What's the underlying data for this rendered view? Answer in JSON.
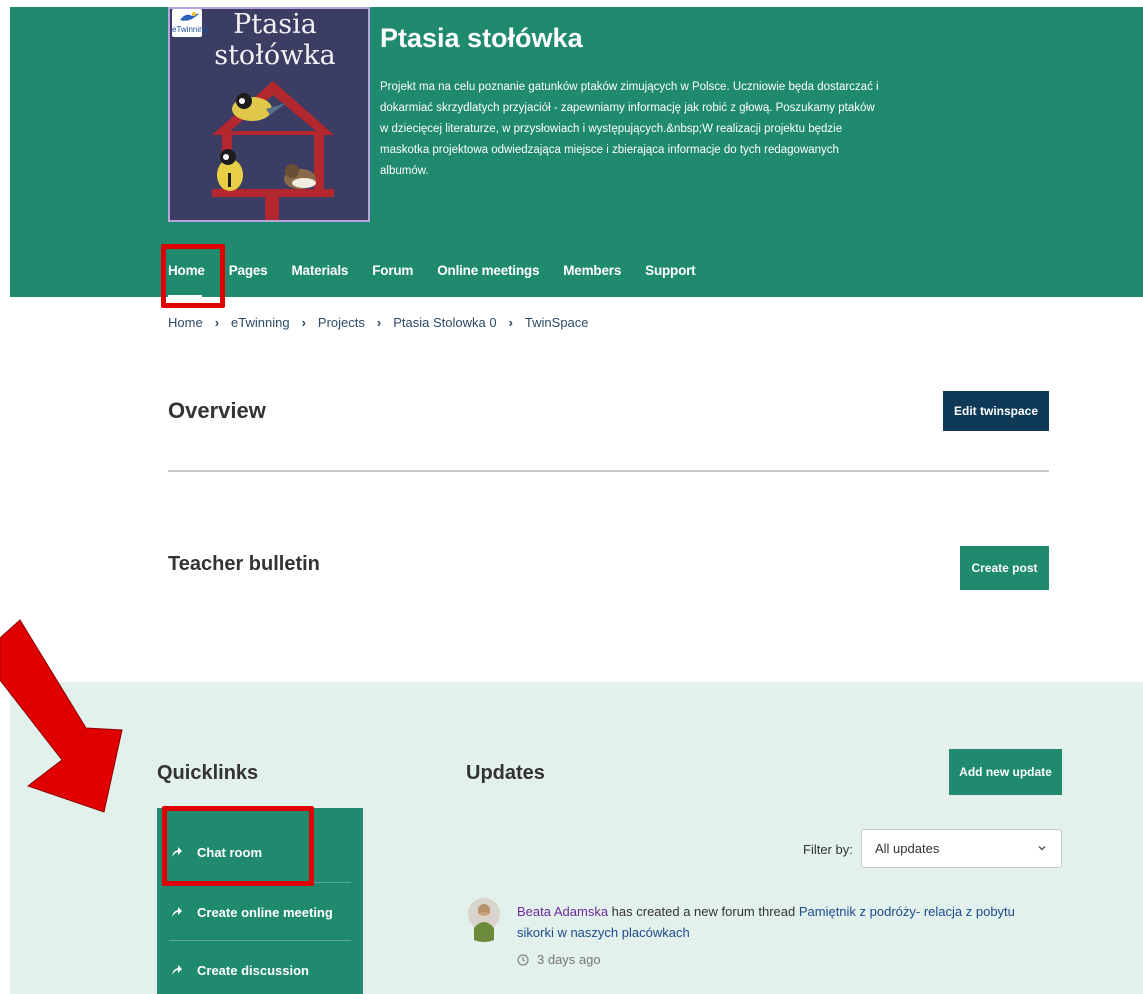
{
  "project": {
    "title": "Ptasia stołówka",
    "cover_title": "Ptasia stołówka",
    "cover_logo_text": "eTwinning",
    "description": "Projekt ma na celu poznanie gatunków ptaków zimujących w Polsce. Uczniowie będa dostarczać i dokarmiać skrzydlatych przyjaciół - zapewniamy informację jak robić z głową. Poszukamy ptaków w dziecięcej literaturze, w przysłowiach i występujących.&nbsp;W realizacji projektu będzie maskotka projektowa odwiedzająca miejsce i zbierająca informacje do tych redagowanych albumów."
  },
  "nav": {
    "items": [
      "Home",
      "Pages",
      "Materials",
      "Forum",
      "Online meetings",
      "Members",
      "Support"
    ],
    "active": "Home"
  },
  "breadcrumb": [
    "Home",
    "eTwinning",
    "Projects",
    "Ptasia Stolowka 0",
    "TwinSpace"
  ],
  "overview": {
    "heading": "Overview",
    "edit_button": "Edit twinspace"
  },
  "bulletin": {
    "heading": "Teacher bulletin",
    "create_button": "Create post"
  },
  "quicklinks": {
    "heading": "Quicklinks",
    "items": [
      "Chat room",
      "Create online meeting",
      "Create discussion"
    ]
  },
  "updates": {
    "heading": "Updates",
    "add_button": "Add new update",
    "filter_label": "Filter by:",
    "filter_value": "All updates",
    "entries": [
      {
        "user": "Beata Adamska",
        "action": " has created a new forum thread ",
        "link": "Pamiętnik z podróży- relacja z pobytu sikorki w naszych placówkach",
        "time": "3 days ago"
      }
    ]
  },
  "colors": {
    "brand_green": "#1f8a6e",
    "dark_navy": "#0e3957",
    "highlight_red": "#e00000",
    "section_bg": "#e3f1ed"
  }
}
